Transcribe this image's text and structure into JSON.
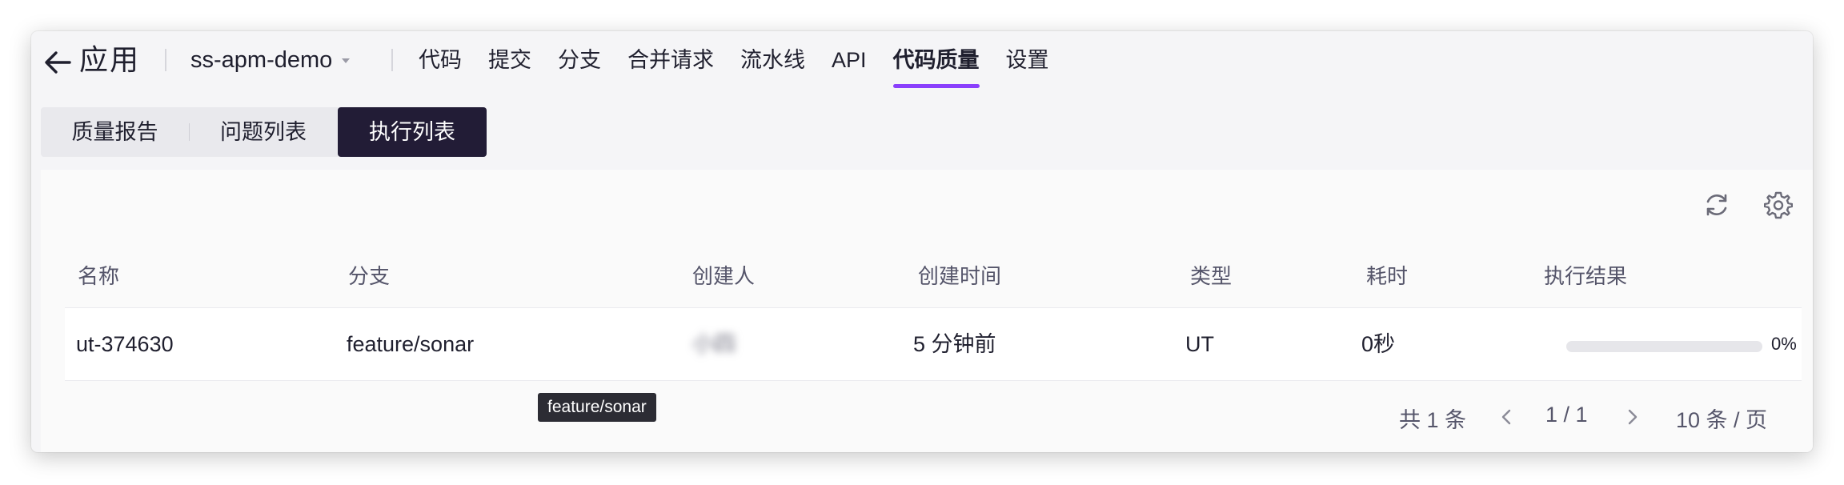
{
  "topnav": {
    "back_title": "应用",
    "project": "ss-apm-demo",
    "tabs": [
      {
        "label": "代码"
      },
      {
        "label": "提交"
      },
      {
        "label": "分支"
      },
      {
        "label": "合并请求"
      },
      {
        "label": "流水线"
      },
      {
        "label": "API"
      },
      {
        "label": "代码质量",
        "active": true
      },
      {
        "label": "设置"
      }
    ]
  },
  "subtabs": [
    {
      "label": "质量报告"
    },
    {
      "label": "问题列表"
    },
    {
      "label": "执行列表",
      "active": true
    }
  ],
  "toolbar": {
    "icons": [
      "refresh-icon",
      "settings-gear-icon"
    ]
  },
  "table": {
    "columns": [
      "名称",
      "分支",
      "创建人",
      "创建时间",
      "类型",
      "耗时",
      "执行结果"
    ],
    "rows": [
      {
        "name": "ut-374630",
        "branch": "feature/sonar",
        "creator": "小四",
        "created": "5 分钟前",
        "type": "UT",
        "duration": "0秒",
        "progress": 0,
        "progress_label": "0%"
      }
    ]
  },
  "tooltip": {
    "text": "feature/sonar"
  },
  "pagination": {
    "total": "共 1 条",
    "page": "1 / 1",
    "page_size": "10 条 / 页"
  },
  "colors": {
    "accent": "#8a3ffc",
    "active_tab_bg": "#221c36"
  }
}
